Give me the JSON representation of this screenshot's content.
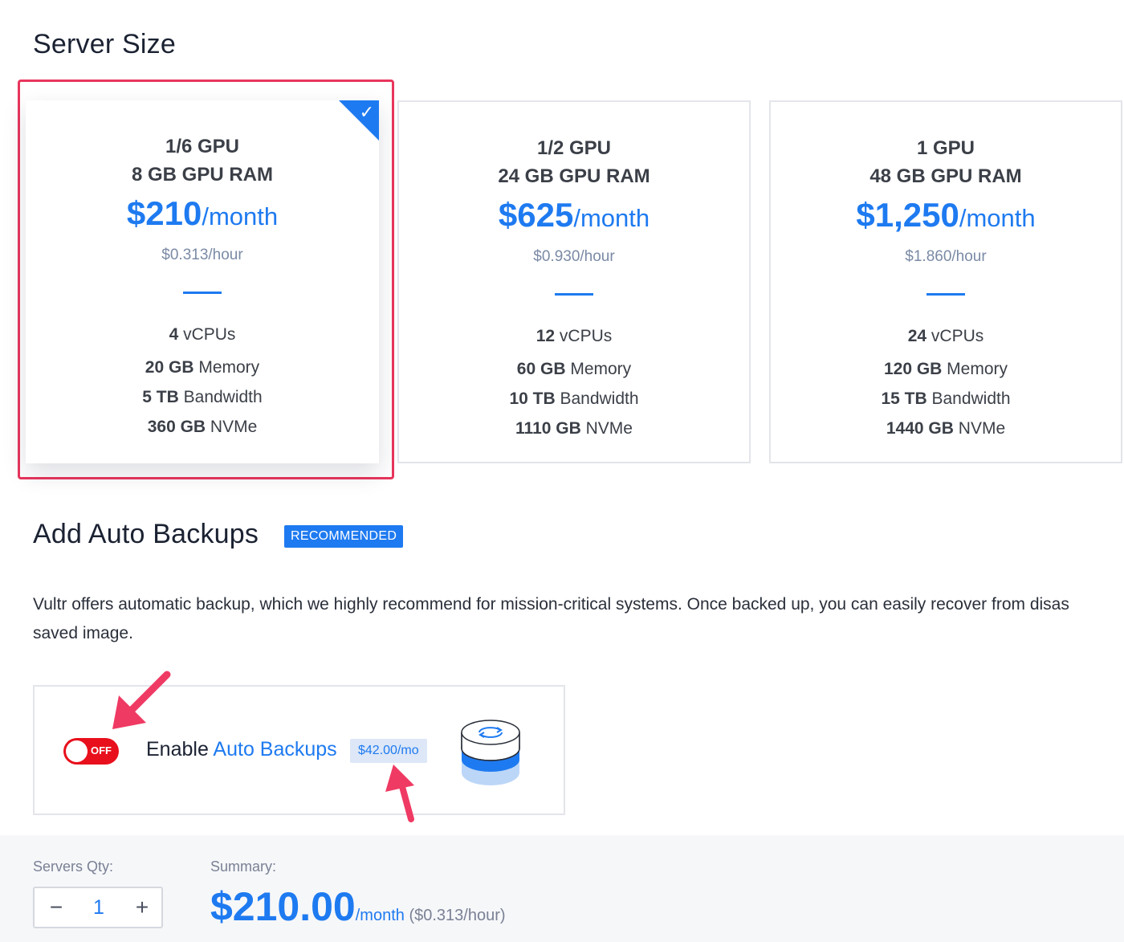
{
  "server_size": {
    "title": "Server Size",
    "plans": [
      {
        "gpu": "1/6 GPU",
        "ram": "8 GB GPU RAM",
        "price": "$210",
        "per": "/month",
        "hourly": "$0.313/hour",
        "vcpus_num": "4",
        "vcpus_label": " vCPUs",
        "memory_num": "20 GB",
        "memory_label": " Memory",
        "bandwidth_num": "5 TB",
        "bandwidth_label": " Bandwidth",
        "storage_num": "360 GB",
        "storage_label": " NVMe",
        "selected": true
      },
      {
        "gpu": "1/2 GPU",
        "ram": "24 GB GPU RAM",
        "price": "$625",
        "per": "/month",
        "hourly": "$0.930/hour",
        "vcpus_num": "12",
        "vcpus_label": " vCPUs",
        "memory_num": "60 GB",
        "memory_label": " Memory",
        "bandwidth_num": "10 TB",
        "bandwidth_label": " Bandwidth",
        "storage_num": "1110 GB",
        "storage_label": " NVMe",
        "selected": false
      },
      {
        "gpu": "1 GPU",
        "ram": "48 GB GPU RAM",
        "price": "$1,250",
        "per": "/month",
        "hourly": "$1.860/hour",
        "vcpus_num": "24",
        "vcpus_label": " vCPUs",
        "memory_num": "120 GB",
        "memory_label": " Memory",
        "bandwidth_num": "15 TB",
        "bandwidth_label": " Bandwidth",
        "storage_num": "1440 GB",
        "storage_label": " NVMe",
        "selected": false
      }
    ]
  },
  "backups": {
    "title": "Add Auto Backups",
    "badge": "RECOMMENDED",
    "description_line1": "Vultr offers automatic backup, which we highly recommend for mission-critical systems. Once backed up, you can easily recover from disas",
    "description_line2": "saved image.",
    "toggle_state": "OFF",
    "enable_prefix": "Enable ",
    "enable_link": "Auto Backups",
    "price": "$42.00/mo",
    "icon": "backup-database-icon"
  },
  "summary_bar": {
    "qty_label": "Servers Qty:",
    "qty_minus": "−",
    "qty_value": "1",
    "qty_plus": "+",
    "summary_label": "Summary:",
    "total": "$210.00",
    "per": "/month",
    "hourly": " ($0.313/hour)"
  },
  "colors": {
    "accent": "#1e7af0",
    "selection": "#e8365d",
    "toggle_off": "#e8101c",
    "annotation_arrow": "#ef3a63"
  }
}
